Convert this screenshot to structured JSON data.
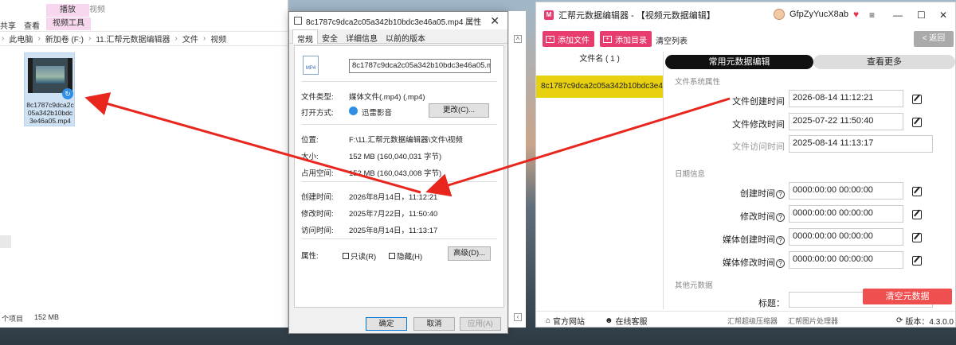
{
  "explorer": {
    "ribbon": {
      "share_tab": "共享",
      "view_tab": "查看",
      "contextual_header": "播放",
      "contextual_tab": "视频工具",
      "contextual_title": "视频"
    },
    "breadcrumb": [
      "此电脑",
      "新加卷 (F:)",
      "11.汇帮元数据编辑器",
      "文件",
      "视频"
    ],
    "file": {
      "name_line1": "8c1787c9dca2c",
      "name_line2": "05a342b10bdc",
      "name_line3": "3e46a05.mp4"
    },
    "status": {
      "items": "个项目",
      "size": "152 MB"
    }
  },
  "properties": {
    "title": "8c1787c9dca2c05a342b10bdc3e46a05.mp4 属性",
    "tabs": [
      "常规",
      "安全",
      "详细信息",
      "以前的版本"
    ],
    "tab_active": "常规",
    "icon_label": "MP4",
    "file_name": "8c1787c9dca2c05a342b10bdc3e46a05.mp4",
    "file_type_label": "文件类型:",
    "file_type_value": "媒体文件(.mp4) (.mp4)",
    "open_with_label": "打开方式:",
    "open_with_value": "迅雷影音",
    "change_button": "更改(C)...",
    "location_label": "位置:",
    "location_value": "F:\\11.汇帮元数据编辑器\\文件\\视频",
    "size_label": "大小:",
    "size_value": "152 MB (160,040,031 字节)",
    "disk_size_label": "占用空间:",
    "disk_size_value": "152 MB (160,043,008 字节)",
    "created_label": "创建时间:",
    "created_value": "2026年8月14日，11:12:21",
    "modified_label": "修改时间:",
    "modified_value": "2025年7月22日，11:50:40",
    "accessed_label": "访问时间:",
    "accessed_value": "2025年8月14日，11:13:17",
    "attributes_label": "属性:",
    "readonly_label": "只读(R)",
    "hidden_label": "隐藏(H)",
    "advanced_button": "高级(D)...",
    "ok_button": "确定",
    "cancel_button": "取消",
    "apply_button": "应用(A)"
  },
  "app": {
    "title": "汇帮元数据编辑器 - 【视频元数据编辑】",
    "logo_letter": "M",
    "username": "GfpZyYucX8ab",
    "toolbar": {
      "add_file": "添加文件",
      "add_dir": "添加目录",
      "clear_list": "清空列表",
      "back": "< 返回"
    },
    "sidebar": {
      "header": "文件名 ( 1 )",
      "file": "8c1787c9dca2c05a342b10bdc3e46a05.mp4"
    },
    "tabs": {
      "common": "常用元数据编辑",
      "more": "查看更多"
    },
    "sections": {
      "filesystem": "文件系统属性",
      "date": "日期信息",
      "other": "其他元数据"
    },
    "fields": {
      "fs_created_label": "文件创建时间",
      "fs_created_value": "2026-08-14 11:12:21",
      "fs_modified_label": "文件修改时间",
      "fs_modified_value": "2025-07-22 11:50:40",
      "fs_accessed_label": "文件访问时间",
      "fs_accessed_value": "2025-08-14 11:13:17",
      "created_label": "创建时间",
      "created_value": "0000:00:00 00:00:00",
      "modified_label": "修改时间",
      "modified_value": "0000:00:00 00:00:00",
      "media_created_label": "媒体创建时间",
      "media_created_value": "0000:00:00 00:00:00",
      "media_modified_label": "媒体修改时间",
      "media_modified_value": "0000:00:00 00:00:00",
      "title_label": "标题："
    },
    "question_mark": "?",
    "clear_metadata": "清空元数据",
    "footer": {
      "website": "官方网站",
      "support": "在线客服",
      "link1": "汇帮超级压缩器",
      "link2": "汇帮图片处理器",
      "version": "版本：4.3.0.0"
    }
  },
  "colors": {
    "accent_pink": "#e83c6e",
    "selected_file": "#e8d20f",
    "clear_button": "#ef4f4f",
    "arrow_red": "#e8261e"
  }
}
